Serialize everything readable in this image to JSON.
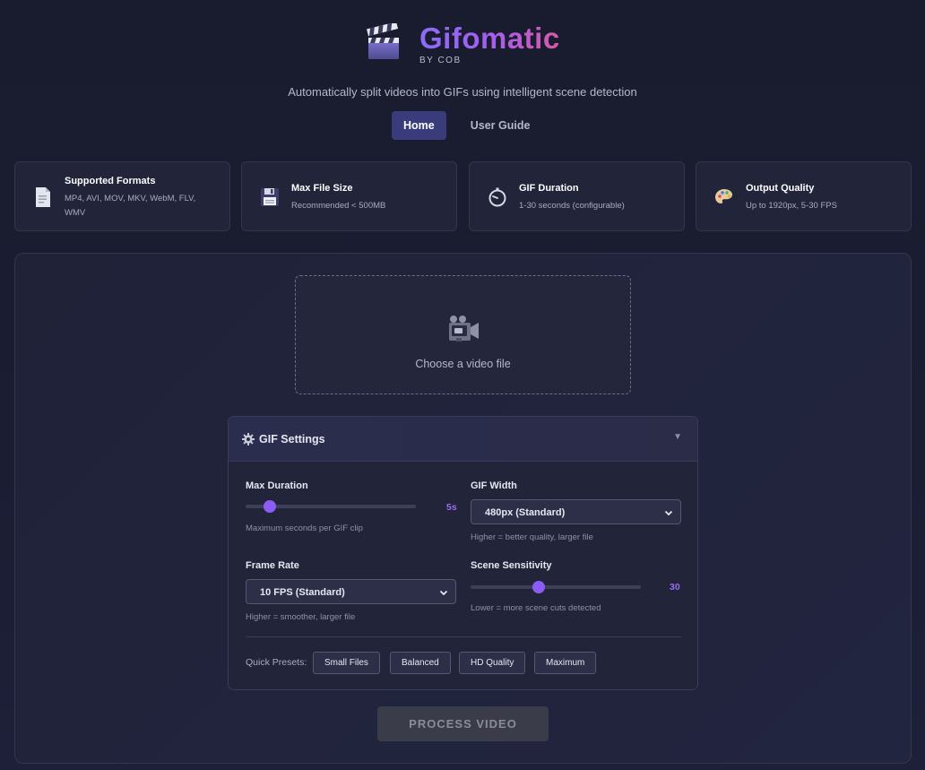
{
  "brand": {
    "title": "Gifomatic",
    "byline": "BY COB",
    "icon": "clapperboard-icon"
  },
  "tagline": "Automatically split videos into GIFs using intelligent scene detection",
  "nav": {
    "tabs": [
      {
        "label": "Home",
        "active": true
      },
      {
        "label": "User Guide",
        "active": false
      }
    ]
  },
  "info_cards": [
    {
      "icon": "document-icon",
      "title": "Supported Formats",
      "desc": "MP4, AVI, MOV, MKV, WebM, FLV, WMV"
    },
    {
      "icon": "floppy-disk-icon",
      "title": "Max File Size",
      "desc": "Recommended < 500MB"
    },
    {
      "icon": "stopwatch-icon",
      "title": "GIF Duration",
      "desc": "1-30 seconds (configurable)"
    },
    {
      "icon": "palette-icon",
      "title": "Output Quality",
      "desc": "Up to 1920px, 5-30 FPS"
    }
  ],
  "upload": {
    "label": "Choose a video file",
    "icon": "video-camera-icon"
  },
  "settings": {
    "title": "GIF Settings",
    "max_duration": {
      "label": "Max Duration",
      "value": "5s",
      "level": 0.14,
      "hint": "Maximum seconds per GIF clip"
    },
    "gif_width": {
      "label": "GIF Width",
      "selected": "480px (Standard)",
      "hint": "Higher = better quality, larger file"
    },
    "frame_rate": {
      "label": "Frame Rate",
      "selected": "10 FPS (Standard)",
      "hint": "Higher = smoother, larger file"
    },
    "scene_sensitivity": {
      "label": "Scene Sensitivity",
      "value": "30",
      "level": 0.4,
      "hint": "Lower = more scene cuts detected"
    },
    "presets_label": "Quick Presets:",
    "presets": [
      "Small Files",
      "Balanced",
      "HD Quality",
      "Maximum"
    ]
  },
  "process_button": {
    "label": "PROCESS VIDEO",
    "enabled": false
  },
  "colors": {
    "accent": "#8b5cf6",
    "background": "#1b1d33",
    "card": "#22243a",
    "active_tab": "#3a3b7a"
  }
}
